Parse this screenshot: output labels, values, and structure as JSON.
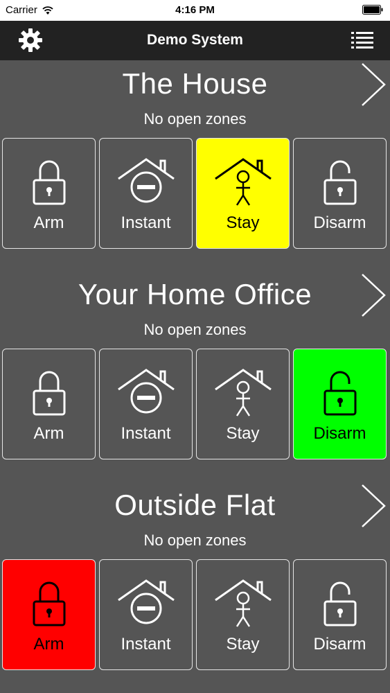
{
  "status_bar": {
    "carrier": "Carrier",
    "time": "4:16 PM",
    "wifi_icon": "wifi-icon",
    "battery_icon": "battery-icon"
  },
  "nav": {
    "title": "Demo System",
    "left_icon": "gear-icon",
    "right_icon": "list-icon"
  },
  "colors": {
    "background": "#555555",
    "nav_background": "#222222",
    "stay_active": "#ffff00",
    "disarm_active": "#00ff00",
    "arm_active": "#ff0000",
    "button_border": "#e6e6e6"
  },
  "areas": [
    {
      "name": "The House",
      "status": "No open zones",
      "active_mode": "stay",
      "buttons": [
        {
          "label": "Arm",
          "icon": "lock-closed-icon"
        },
        {
          "label": "Instant",
          "icon": "house-minus-icon"
        },
        {
          "label": "Stay",
          "icon": "house-person-icon"
        },
        {
          "label": "Disarm",
          "icon": "lock-open-icon"
        }
      ]
    },
    {
      "name": "Your Home Office",
      "status": "No open zones",
      "active_mode": "disarm",
      "buttons": [
        {
          "label": "Arm",
          "icon": "lock-closed-icon"
        },
        {
          "label": "Instant",
          "icon": "house-minus-icon"
        },
        {
          "label": "Stay",
          "icon": "house-person-icon"
        },
        {
          "label": "Disarm",
          "icon": "lock-open-icon"
        }
      ]
    },
    {
      "name": "Outside Flat",
      "status": "No open zones",
      "active_mode": "arm",
      "buttons": [
        {
          "label": "Arm",
          "icon": "lock-closed-icon"
        },
        {
          "label": "Instant",
          "icon": "house-minus-icon"
        },
        {
          "label": "Stay",
          "icon": "house-person-icon"
        },
        {
          "label": "Disarm",
          "icon": "lock-open-icon"
        }
      ]
    }
  ]
}
